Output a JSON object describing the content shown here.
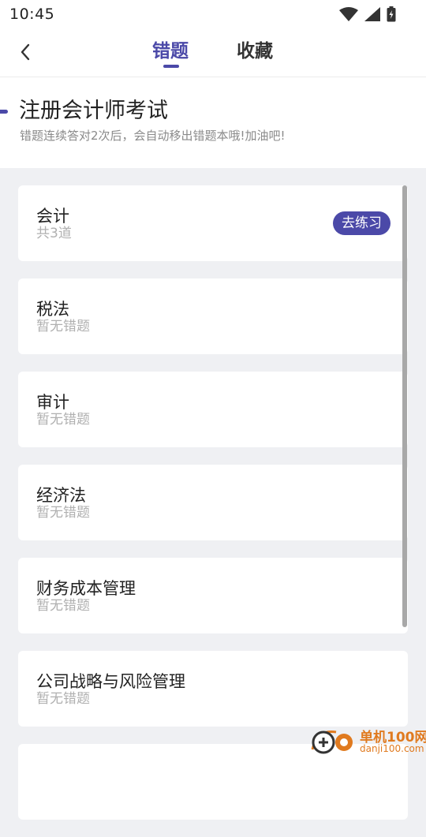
{
  "status_bar": {
    "time": "10:45",
    "icons": [
      "wifi-icon",
      "signal-icon",
      "battery-icon"
    ]
  },
  "header": {
    "tabs": [
      {
        "label": "错题",
        "active": true
      },
      {
        "label": "收藏",
        "active": false
      }
    ]
  },
  "exam": {
    "title": "注册会计师考试",
    "subtitle": "错题连续答对2次后，会自动移出错题本哦!加油吧!"
  },
  "subjects": [
    {
      "name": "会计",
      "status": "共3道",
      "action": "去练习"
    },
    {
      "name": "税法",
      "status": "暂无错题"
    },
    {
      "name": "审计",
      "status": "暂无错题"
    },
    {
      "name": "经济法",
      "status": "暂无错题"
    },
    {
      "name": "财务成本管理",
      "status": "暂无错题"
    },
    {
      "name": "公司战略与风险管理",
      "status": "暂无错题"
    }
  ],
  "watermark": {
    "name": "单机100网",
    "url": "danji100.com"
  },
  "colors": {
    "accent": "#4b49a8",
    "background": "#eff0f3",
    "watermark": "#e07a1f"
  }
}
